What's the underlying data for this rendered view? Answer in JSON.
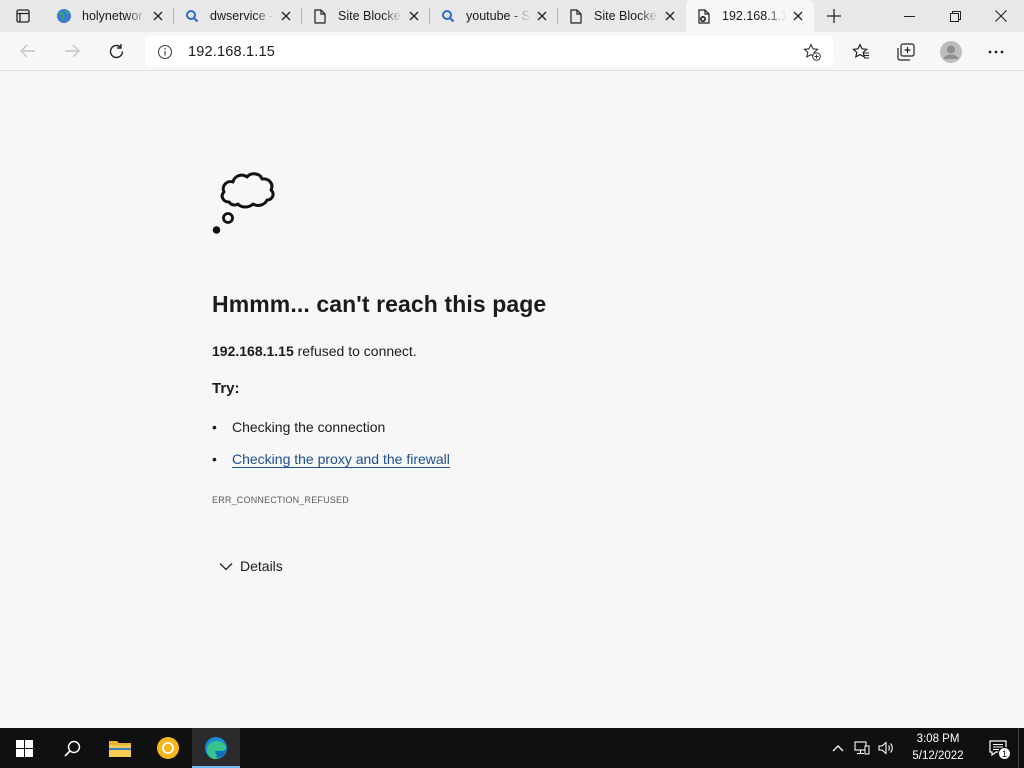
{
  "browser": {
    "tabs": [
      {
        "title": "holynetwor",
        "icon": "globe-icon"
      },
      {
        "title": "dwservice -",
        "icon": "search-icon"
      },
      {
        "title": "Site Blocked",
        "icon": "page-icon"
      },
      {
        "title": "youtube - S",
        "icon": "search-icon"
      },
      {
        "title": "Site Blocked",
        "icon": "page-icon"
      },
      {
        "title": "192.168.1.15",
        "icon": "error-page-icon",
        "active": true
      }
    ],
    "address": {
      "url": "192.168.1.15"
    }
  },
  "error_page": {
    "heading": "Hmmm... can't reach this page",
    "host": "192.168.1.15",
    "message": "refused to connect.",
    "try_label": "Try:",
    "suggestions": [
      {
        "text": "Checking the connection",
        "link": false
      },
      {
        "text": "Checking the proxy and the firewall",
        "link": true
      }
    ],
    "error_code": "ERR_CONNECTION_REFUSED",
    "details_label": "Details"
  },
  "taskbar": {
    "time": "3:08 PM",
    "date": "5/12/2022",
    "notification_count": "1"
  },
  "colors": {
    "link": "#1d4e8c",
    "taskbar": "#101010",
    "page_bg": "#f7f7f7"
  }
}
